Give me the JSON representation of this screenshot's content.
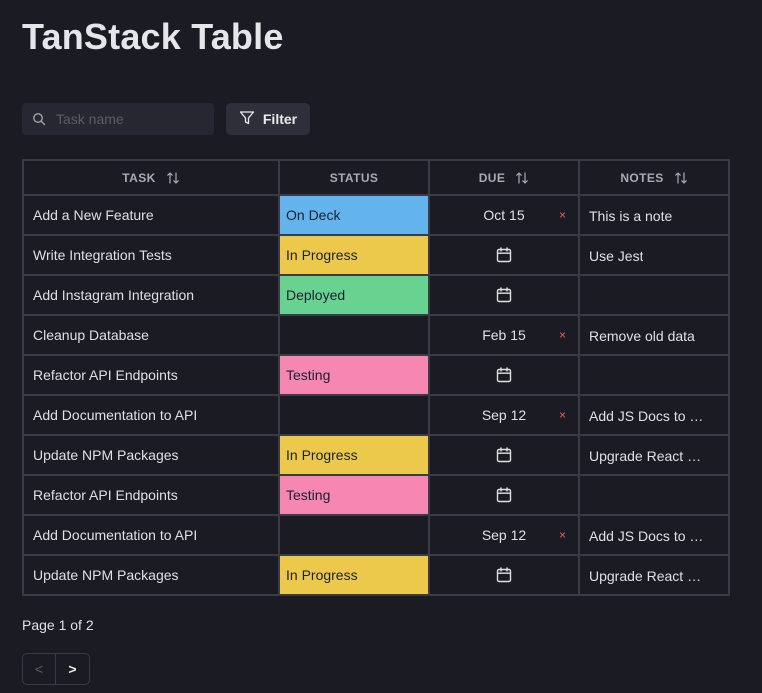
{
  "page": {
    "title": "TanStack Table"
  },
  "toolbar": {
    "search_placeholder": "Task name",
    "search_value": "",
    "filter_label": "Filter"
  },
  "table": {
    "columns": [
      {
        "label": "Task",
        "sortable": true
      },
      {
        "label": "Status",
        "sortable": false
      },
      {
        "label": "Due",
        "sortable": true
      },
      {
        "label": "Notes",
        "sortable": true
      }
    ],
    "status_colors": {
      "On Deck": "#63b3ed",
      "In Progress": "#ecc94b",
      "Deployed": "#68d391",
      "Testing": "#f687b3"
    },
    "rows": [
      {
        "task": "Add a New Feature",
        "status": "On Deck",
        "due": "Oct 15",
        "notes": "This is a note"
      },
      {
        "task": "Write Integration Tests",
        "status": "In Progress",
        "due": "",
        "notes": "Use Jest"
      },
      {
        "task": "Add Instagram Integration",
        "status": "Deployed",
        "due": "",
        "notes": ""
      },
      {
        "task": "Cleanup Database",
        "status": "",
        "due": "Feb 15",
        "notes": "Remove old data"
      },
      {
        "task": "Refactor API Endpoints",
        "status": "Testing",
        "due": "",
        "notes": ""
      },
      {
        "task": "Add Documentation to API",
        "status": "",
        "due": "Sep 12",
        "notes": "Add JS Docs to all endpoints"
      },
      {
        "task": "Update NPM Packages",
        "status": "In Progress",
        "due": "",
        "notes": "Upgrade React & Chakra UI"
      },
      {
        "task": "Refactor API Endpoints",
        "status": "Testing",
        "due": "",
        "notes": ""
      },
      {
        "task": "Add Documentation to API",
        "status": "",
        "due": "Sep 12",
        "notes": "Add JS Docs to all endpoints"
      },
      {
        "task": "Update NPM Packages",
        "status": "In Progress",
        "due": "",
        "notes": "Upgrade React & Chakra UI"
      }
    ],
    "clear_date_glyph": "×"
  },
  "pagination": {
    "page_info": "Page 1 of 2",
    "prev_label": "<",
    "next_label": ">"
  }
}
